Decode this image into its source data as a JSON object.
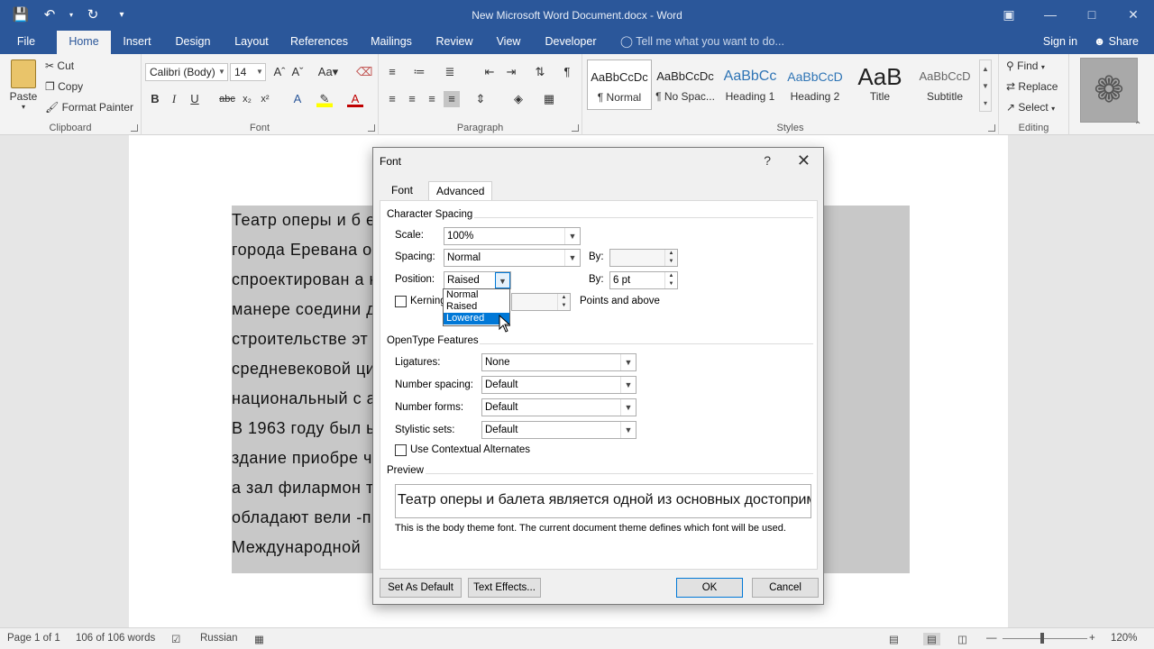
{
  "window": {
    "title": "New Microsoft Word Document.docx - Word",
    "controls": [
      "restore-ribbon",
      "minimize",
      "maximize",
      "close"
    ]
  },
  "qat": {
    "save": "save-icon",
    "undo": "undo-icon",
    "redo": "redo-icon",
    "customize": "customize-icon"
  },
  "tabs": [
    "File",
    "Home",
    "Insert",
    "Design",
    "Layout",
    "References",
    "Mailings",
    "Review",
    "View",
    "Developer"
  ],
  "tell_me": "Tell me what you want to do...",
  "sign_in": "Sign in",
  "share": "Share",
  "clipboard": {
    "paste": "Paste",
    "cut": "Cut",
    "copy": "Copy",
    "format_painter": "Format Painter",
    "group": "Clipboard"
  },
  "font": {
    "name": "Calibri (Body)",
    "size": "14",
    "group": "Font"
  },
  "paragraph": {
    "group": "Paragraph"
  },
  "styles": {
    "items": [
      {
        "sample": "AaBbCcDc",
        "name": "¶ Normal"
      },
      {
        "sample": "AaBbCcDc",
        "name": "¶ No Spac..."
      },
      {
        "sample": "AaBbCc",
        "name": "Heading 1"
      },
      {
        "sample": "AaBbCcD",
        "name": "Heading 2"
      },
      {
        "sample": "AaB",
        "name": "Title"
      },
      {
        "sample": "AaBbCcD",
        "name": "Subtitle"
      }
    ],
    "group": "Styles"
  },
  "editing": {
    "find": "Find",
    "replace": "Replace",
    "select": "Select",
    "group": "Editing"
  },
  "document": {
    "lines": [
      "Театр оперы и б                                                                          ельностей",
      "города  Еревана                                                                      он  был",
      "спроектирован а                                                                        необычной",
      "манере  соедини                                                                         дании.  В",
      "строительстве эт                                                                       традиции",
      "средневековой                                                                            ционный",
      "национальный с                                                                         а в 1939 г.",
      "В  1963  году  был                                                                        ьный  вид",
      "здание приобре                                                                          человек,",
      "а  зал  филармон                                                                       театра  и",
      "обладают  вели                                                                          -при»  на",
      "Международной"
    ]
  },
  "dialog": {
    "title": "Font",
    "help": "?",
    "tabs": [
      "Font",
      "Advanced"
    ],
    "character_spacing": {
      "heading": "Character Spacing",
      "scale_label": "Scale:",
      "scale_value": "100%",
      "spacing_label": "Spacing:",
      "spacing_value": "Normal",
      "spacing_by_label": "By:",
      "spacing_by_value": "",
      "position_label": "Position:",
      "position_value": "Raised",
      "position_by_label": "By:",
      "position_by_value": "6 pt",
      "kerning_label": "Kerning",
      "kerning_suffix": "Points and above",
      "position_options": [
        "Normal",
        "Raised",
        "Lowered"
      ],
      "position_highlighted": "Lowered"
    },
    "opentype": {
      "heading": "OpenType Features",
      "ligatures_label": "Ligatures:",
      "ligatures_value": "None",
      "number_spacing_label": "Number spacing:",
      "number_spacing_value": "Default",
      "number_forms_label": "Number forms:",
      "number_forms_value": "Default",
      "stylistic_sets_label": "Stylistic sets:",
      "stylistic_sets_value": "Default",
      "contextual_label": "Use Contextual Alternates"
    },
    "preview": {
      "heading": "Preview",
      "text": "Театр оперы и балета является одной из основных достопримечательностей",
      "note": "This is the body theme font. The current document theme defines which font will be used."
    },
    "buttons": {
      "set_default": "Set As Default",
      "text_effects": "Text Effects...",
      "ok": "OK",
      "cancel": "Cancel"
    }
  },
  "status": {
    "page": "Page 1 of 1",
    "words": "106 of 106 words",
    "language": "Russian",
    "zoom": "120%"
  },
  "colors": {
    "brand": "#2b579a",
    "selection": "#c8c8c8",
    "highlight": "#0078d7"
  }
}
